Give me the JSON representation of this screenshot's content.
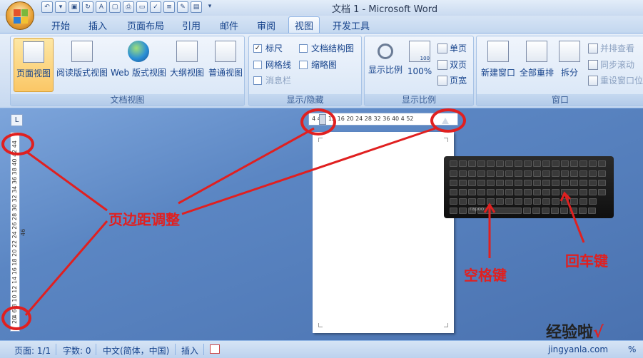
{
  "window": {
    "title": "文档 1 - Microsoft Word"
  },
  "tabs": [
    "开始",
    "插入",
    "页面布局",
    "引用",
    "邮件",
    "审阅",
    "视图",
    "开发工具"
  ],
  "active_tab": "视图",
  "ribbon": {
    "doc_views": {
      "label": "文档视图",
      "buttons": [
        "页面视图",
        "阅读版式视图",
        "Web 版式视图",
        "大纲视图",
        "普通视图"
      ]
    },
    "show_hide": {
      "label": "显示/隐藏",
      "items": [
        {
          "text": "标尺",
          "checked": true
        },
        {
          "text": "文档结构图",
          "checked": false
        },
        {
          "text": "网格线",
          "checked": false
        },
        {
          "text": "缩略图",
          "checked": false
        },
        {
          "text": "消息栏",
          "checked": false,
          "disabled": true
        }
      ]
    },
    "zoom": {
      "label": "显示比例",
      "zoom_btn": "显示比例",
      "pct_btn": "100%",
      "one_page": "单页",
      "two_page": "双页",
      "page_width": "页宽",
      "pct_icon_text": "100"
    },
    "window": {
      "label": "窗口",
      "new_window": "新建窗口",
      "arrange_all": "全部重排",
      "split": "拆分",
      "side_by_side": "并排查看",
      "sync_scroll": "同步滚动",
      "reset_pos": "重设窗口位"
    }
  },
  "rulers": {
    "horizontal": "4  4  8  12  16  20  24  28  32  36  40  4  52",
    "vertical": "2 4 6 8 10 12 14 16 18 20 22 24 26 28 30 32 34 36 38 40 42 44 46",
    "vertical_bottom": "0",
    "tab_selector": "L"
  },
  "statusbar": {
    "page": "页面: 1/1",
    "words": "字数: 0",
    "lang": "中文(简体，中国)",
    "mode": "插入",
    "zoom_pct": "%"
  },
  "annotations": {
    "margin": "页边距调整",
    "space": "空格键",
    "enter": "回车键"
  },
  "keyboard": {
    "brand": "rapoo"
  },
  "watermark": {
    "line1": "经验啦",
    "check": "√",
    "line2": "jingyanla.com"
  }
}
